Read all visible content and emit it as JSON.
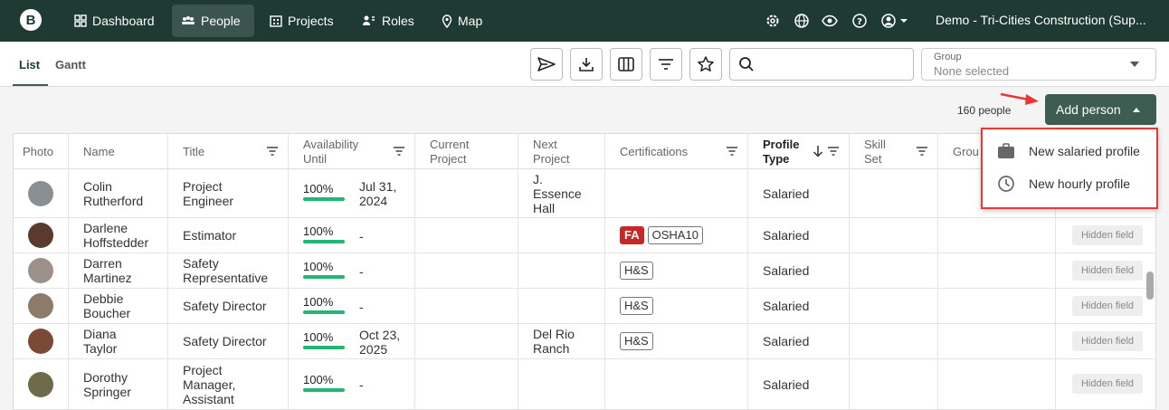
{
  "nav": {
    "logo": "B",
    "items": [
      {
        "label": "Dashboard",
        "icon": "dashboard-icon"
      },
      {
        "label": "People",
        "icon": "people-icon",
        "active": true
      },
      {
        "label": "Projects",
        "icon": "building-icon"
      },
      {
        "label": "Roles",
        "icon": "roles-icon"
      },
      {
        "label": "Map",
        "icon": "map-pin-icon"
      }
    ],
    "right_icons": [
      "gear-icon",
      "globe-icon",
      "eye-icon",
      "help-icon",
      "account-icon"
    ],
    "org_name": "Demo - Tri-Cities Construction (Sup..."
  },
  "toolbar": {
    "tabs": [
      {
        "label": "List",
        "active": true
      },
      {
        "label": "Gantt"
      }
    ],
    "buttons": [
      "send-icon",
      "download-icon",
      "columns-icon",
      "filter-icon",
      "star-icon"
    ],
    "search_placeholder": "",
    "group_label": "Group",
    "group_value": "None selected"
  },
  "people_count": "160 people",
  "add_person": {
    "label": "Add person",
    "menu": [
      {
        "label": "New salaried profile",
        "icon": "briefcase-icon"
      },
      {
        "label": "New hourly profile",
        "icon": "clock-icon"
      }
    ]
  },
  "table": {
    "headers": {
      "photo": "Photo",
      "name": "Name",
      "title": "Title",
      "avail1": "Availability",
      "avail2": "Until",
      "cur1": "Current",
      "cur2": "Project",
      "next1": "Next",
      "next2": "Project",
      "certs": "Certifications",
      "ptype1": "Profile",
      "ptype2": "Type",
      "skill1": "Skill",
      "skill2": "Set",
      "group": "Grou"
    },
    "hidden_field": "Hidden field",
    "rows": [
      {
        "first": "Colin",
        "last": "Rutherford",
        "title": [
          "Project",
          "Engineer"
        ],
        "avail": "100%",
        "until": [
          "Jul 31,",
          "2024"
        ],
        "next": [
          "J.",
          "Essence",
          "Hall"
        ],
        "certs": [],
        "ptype": "Salaried",
        "avatar_color": "#8a8f93"
      },
      {
        "first": "Darlene",
        "last": "Hoffstedder",
        "title": [
          "Estimator"
        ],
        "avail": "100%",
        "until": [
          "-"
        ],
        "next": [],
        "certs": [
          {
            "text": "FA",
            "red": true
          },
          {
            "text": "OSHA10"
          }
        ],
        "ptype": "Salaried",
        "avatar_color": "#5b3a2e"
      },
      {
        "first": "Darren",
        "last": "Martinez",
        "title": [
          "Safety",
          "Representative"
        ],
        "avail": "100%",
        "until": [
          "-"
        ],
        "next": [],
        "certs": [
          {
            "text": "H&S"
          }
        ],
        "ptype": "Salaried",
        "avatar_color": "#9c9189"
      },
      {
        "first": "Debbie",
        "last": "Boucher",
        "title": [
          "Safety Director"
        ],
        "avail": "100%",
        "until": [
          "-"
        ],
        "next": [],
        "certs": [
          {
            "text": "H&S"
          }
        ],
        "ptype": "Salaried",
        "avatar_color": "#8d7b6a"
      },
      {
        "first": "Diana",
        "last": "Taylor",
        "title": [
          "Safety Director"
        ],
        "avail": "100%",
        "until": [
          "Oct 23,",
          "2025"
        ],
        "next": [
          "Del Rio",
          "Ranch"
        ],
        "certs": [
          {
            "text": "H&S"
          }
        ],
        "ptype": "Salaried",
        "avatar_color": "#7a4a36"
      },
      {
        "first": "Dorothy",
        "last": "Springer",
        "title": [
          "Project",
          "Manager,",
          "Assistant"
        ],
        "avail": "100%",
        "until": [
          "-"
        ],
        "next": [],
        "certs": [],
        "ptype": "Salaried",
        "avatar_color": "#6e6a4a"
      }
    ]
  },
  "colors": {
    "nav_bg": "#1f3a32",
    "accent": "#3d5c52",
    "progress": "#22b573",
    "highlight": "#e53935",
    "badge_red": "#c62828"
  }
}
